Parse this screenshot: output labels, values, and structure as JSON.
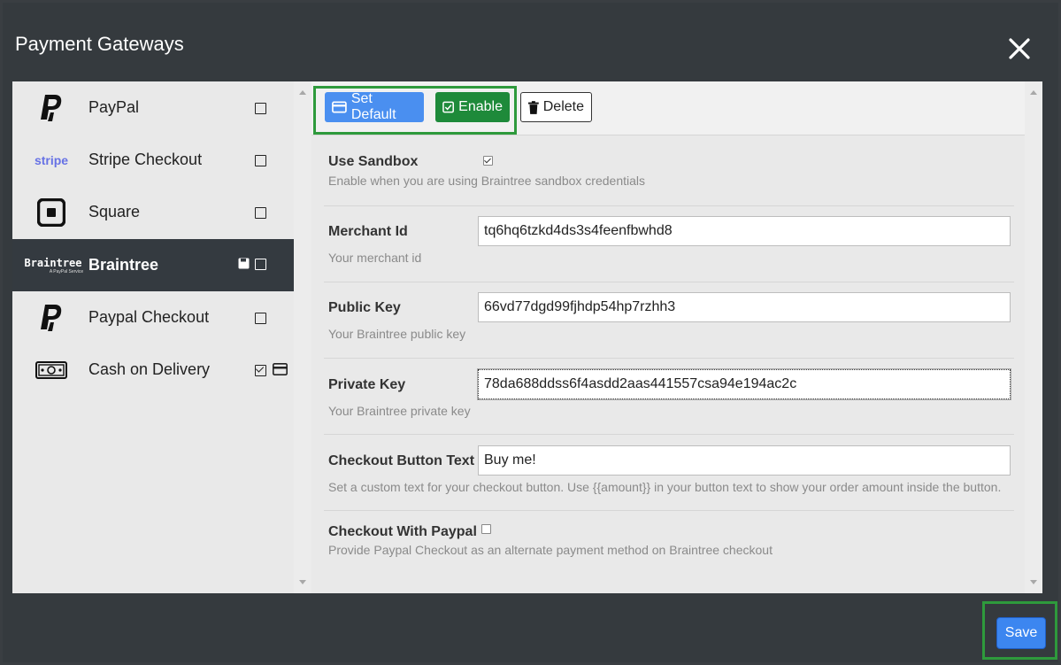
{
  "modal": {
    "title": "Payment Gateways"
  },
  "sidebar": {
    "items": [
      {
        "label": "PayPal",
        "icon": "paypal-icon",
        "enabled": false
      },
      {
        "label": "Stripe Checkout",
        "icon": "stripe-icon",
        "logo_text": "stripe",
        "enabled": false
      },
      {
        "label": "Square",
        "icon": "square-icon",
        "enabled": false
      },
      {
        "label": "Braintree",
        "icon": "braintree-icon",
        "logo_text": "Braintree",
        "logo_subtext": "A PayPal Service",
        "enabled": false,
        "active": true
      },
      {
        "label": "Paypal Checkout",
        "icon": "paypal-icon",
        "enabled": false
      },
      {
        "label": "Cash on Delivery",
        "icon": "cash-icon",
        "enabled": true,
        "default": true
      }
    ]
  },
  "toolbar": {
    "set_default_label": "Set Default",
    "enable_label": "Enable",
    "delete_label": "Delete"
  },
  "form": {
    "use_sandbox": {
      "label": "Use Sandbox",
      "checked": true,
      "hint": "Enable when you are using Braintree sandbox credentials"
    },
    "merchant_id": {
      "label": "Merchant Id",
      "value": "tq6hq6tzkd4ds3s4feenfbwhd8",
      "hint": "Your merchant id"
    },
    "public_key": {
      "label": "Public Key",
      "value": "66vd77dgd99fjhdp54hp7rzhh3",
      "hint": "Your Braintree public key"
    },
    "private_key": {
      "label": "Private Key",
      "value": "78da688ddss6f4asdd2aas441557csa94e194ac2c",
      "hint": "Your Braintree private key"
    },
    "checkout_button_text": {
      "label": "Checkout Button Text",
      "value": "Buy me!",
      "hint": "Set a custom text for your checkout button. Use {{amount}} in your button text to show your order amount inside the button."
    },
    "checkout_with_paypal": {
      "label": "Checkout With Paypal",
      "checked": false,
      "hint": "Provide Paypal Checkout as an alternate payment method on Braintree checkout"
    }
  },
  "footer": {
    "save_label": "Save"
  },
  "colors": {
    "accent": "#4a8ff0",
    "enable": "#1e8a3a",
    "highlight": "#2e9a3c",
    "dark": "#343a40"
  }
}
